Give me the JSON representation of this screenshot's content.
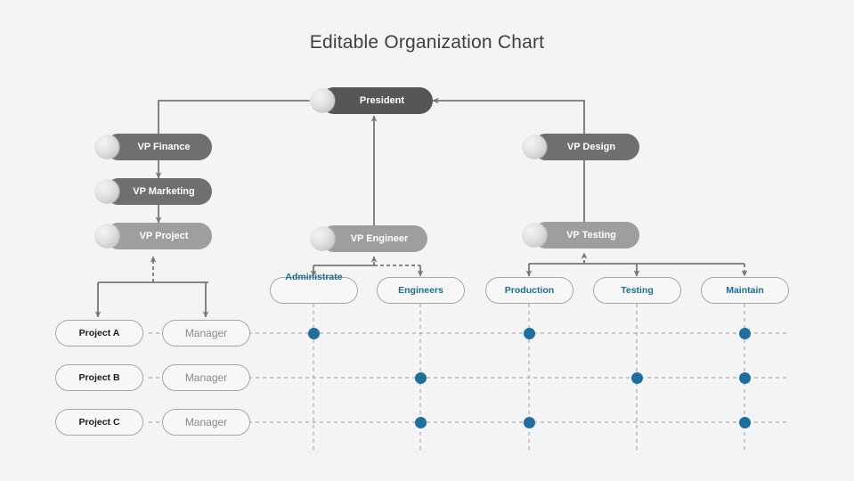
{
  "page": {
    "title": "Editable Organization Chart",
    "background_color": "#f4f4f4"
  },
  "colors": {
    "node_dark": "#565656",
    "node_mid": "#6f6f6f",
    "node_light": "#9e9e9e",
    "box_border": "#a6a6a6",
    "box_text_teal": "#1f6b91",
    "dot": "#1f6f9e",
    "connector": "#767676",
    "title_text": "#3f3f3f"
  },
  "org": {
    "root": {
      "label": "President",
      "tone": "dark"
    },
    "executives": [
      {
        "label": "VP Finance",
        "tone": "mid"
      },
      {
        "label": "VP Marketing",
        "tone": "mid"
      },
      {
        "label": "VP Project",
        "tone": "light"
      },
      {
        "label": "VP Design",
        "tone": "mid"
      },
      {
        "label": "VP Engineer",
        "tone": "light"
      },
      {
        "label": "VP Testing",
        "tone": "light"
      }
    ],
    "functions": [
      {
        "label": "Administrate",
        "parent": "VP Engineer"
      },
      {
        "label": "Engineers",
        "parent": "VP Engineer"
      },
      {
        "label": "Production",
        "parent": "VP Testing"
      },
      {
        "label": "Testing",
        "parent": "VP Testing"
      },
      {
        "label": "Maintain",
        "parent": "VP Testing"
      }
    ],
    "projects": [
      {
        "name": "Project A",
        "role": "Manager"
      },
      {
        "name": "Project B",
        "role": "Manager"
      },
      {
        "name": "Project C",
        "role": "Manager"
      }
    ]
  },
  "matrix": {
    "columns": [
      "Administrate",
      "Engineers",
      "Production",
      "Testing",
      "Maintain"
    ],
    "rows": [
      "Project A",
      "Project B",
      "Project C"
    ],
    "assignments": [
      [
        true,
        false,
        true,
        false,
        true
      ],
      [
        false,
        true,
        false,
        true,
        true
      ],
      [
        false,
        true,
        true,
        false,
        true
      ]
    ]
  }
}
